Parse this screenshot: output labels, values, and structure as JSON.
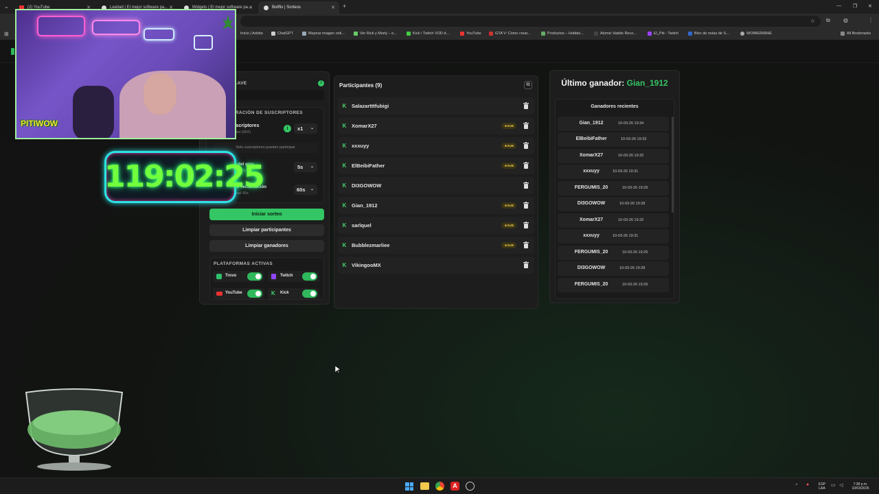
{
  "browser": {
    "tabs": [
      {
        "label": "(2) YouTube",
        "active": false
      },
      {
        "label": "Leeitad | El mejor software pa...",
        "active": false
      },
      {
        "label": "Widgets | El mejor software pa...",
        "active": false
      },
      {
        "label": "Botflix | Sorteos",
        "active": true
      }
    ],
    "new_tab_symbol": "+",
    "bookmarks": [
      "Inicio | Adobe",
      "ChatGPT",
      "Mejorar imagen onli...",
      "Ver Rick y Morty – o...",
      "Kick / Twitch VOD d...",
      "YouTube",
      "GTA V: Cómo crear...",
      "Productos – Hobbie...",
      "Atomic Habits Reco...",
      "El_Piti - Twitch",
      "Bloc de notas de S...",
      "WOMIER68HE"
    ],
    "all_bookmarks": "All Bookmarks"
  },
  "overlay": {
    "timer": "119:02:25",
    "cam_brand": "PITIWOW"
  },
  "config": {
    "key_title": "CLAVE",
    "subs_section_title": "CONFIGURACIÓN DE SUSCRIPTORES",
    "extra_subs_label": "Extra suscriptores",
    "extra_subs_sub": "Valor suscriptor (OFF)",
    "extra_subs_value": "x1",
    "subs_only_note": "Solo suscriptores pueden participar",
    "spin_label": "Duración del giro",
    "spin_sub": "Duración actual: 5s",
    "spin_value": "5s",
    "claim_label": "Tiempo de reclamación",
    "claim_sub": "Duración actual: 60s",
    "claim_value": "60s",
    "start_button": "Iniciar sorteo",
    "clear_participants": "Limpiar participantes",
    "clear_winners": "Limpiar ganadores",
    "platforms_title": "PLATAFORMAS ACTIVAS",
    "platforms": [
      {
        "name": "Trovo",
        "on": true
      },
      {
        "name": "Twitch",
        "on": true
      },
      {
        "name": "YouTube",
        "on": true
      },
      {
        "name": "Kick",
        "on": true
      }
    ]
  },
  "participants": {
    "title": "Participantes (9)",
    "sub_badge": "SUB",
    "list": [
      {
        "name": "Salazartttfubigi",
        "sub": false
      },
      {
        "name": "XomarX27",
        "sub": true
      },
      {
        "name": "xxxuyy",
        "sub": true
      },
      {
        "name": "ElBeibiFather",
        "sub": true
      },
      {
        "name": "DI3GOWOW",
        "sub": false
      },
      {
        "name": "Gian_1912",
        "sub": true
      },
      {
        "name": "sarlquel",
        "sub": true
      },
      {
        "name": "Bubblezmarliee",
        "sub": true
      },
      {
        "name": "VikingooMX",
        "sub": false
      }
    ]
  },
  "winners": {
    "last_label": "Último ganador:",
    "last_name": "Gian_1912",
    "recent_title": "Ganadores recientes",
    "list": [
      {
        "name": "Gian_1912",
        "date": "10-03-26 19:34"
      },
      {
        "name": "ElBeibiFather",
        "date": "10-03-26 19:33"
      },
      {
        "name": "XomarX27",
        "date": "10-03-26 19:32"
      },
      {
        "name": "xxxuyy",
        "date": "10-03-26 19:31"
      },
      {
        "name": "FERGUMIS_20",
        "date": "10-03-26 19:29"
      },
      {
        "name": "DI3GOWOW",
        "date": "10-03-26 19:28"
      },
      {
        "name": "XomarX27",
        "date": "10-03-26 19:32"
      },
      {
        "name": "xxxuyy",
        "date": "10-03-26 19:31"
      },
      {
        "name": "FERGUMIS_20",
        "date": "10-03-26 19:29"
      },
      {
        "name": "DI3GOWOW",
        "date": "10-03-26 19:28"
      },
      {
        "name": "FERGUMIS_20",
        "date": "10-03-26 19:29"
      }
    ]
  },
  "taskbar": {
    "lang_top": "ESP",
    "lang_bottom": "LAA",
    "time": "7:38 p.m.",
    "date": "10/03/2026"
  },
  "colors": {
    "accent_green": "#34c564",
    "kick_green": "#46d36a",
    "sub_gold": "#e6c34b",
    "timer_green": "#72ff3d",
    "timer_border": "#2de3e3"
  }
}
